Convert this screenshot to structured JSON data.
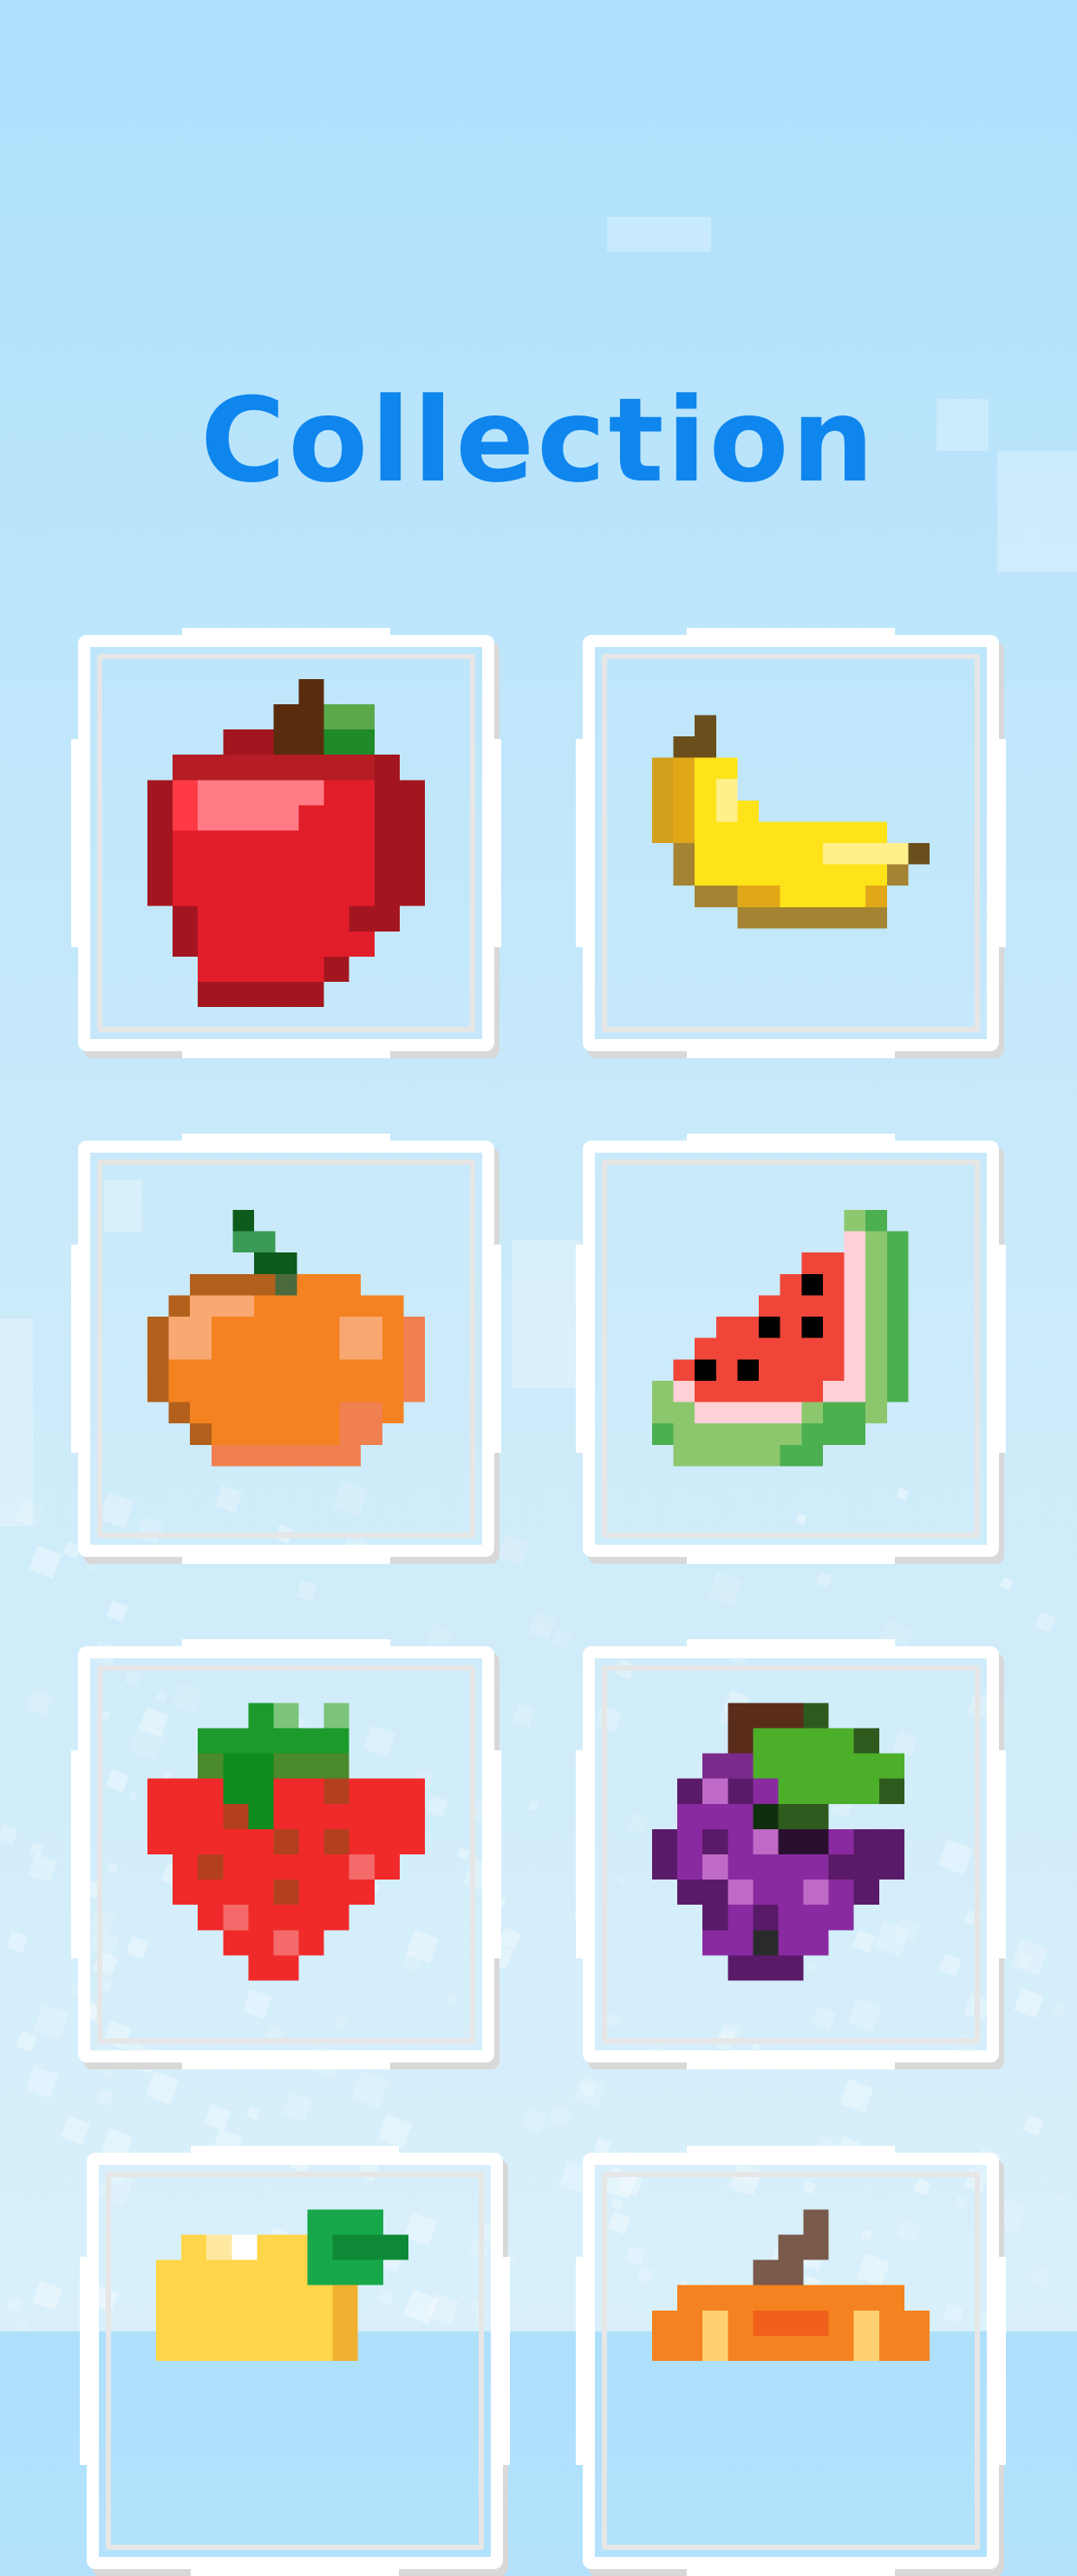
{
  "header": {
    "title": "Collection"
  },
  "collection": {
    "items": [
      {
        "icon": "apple-icon"
      },
      {
        "icon": "banana-icon"
      },
      {
        "icon": "orange-icon"
      },
      {
        "icon": "watermelon-icon"
      },
      {
        "icon": "strawberry-icon"
      },
      {
        "icon": "grapes-icon"
      },
      {
        "icon": "lemon-icon"
      },
      {
        "icon": "pumpkin-icon"
      }
    ]
  },
  "colors": {
    "title": "#0f86ee",
    "card_border": "#ffffff",
    "card_inner_border": "#e6e6e6",
    "background_top": "#aee0fc",
    "background_bottom": "#d9f0fb"
  }
}
